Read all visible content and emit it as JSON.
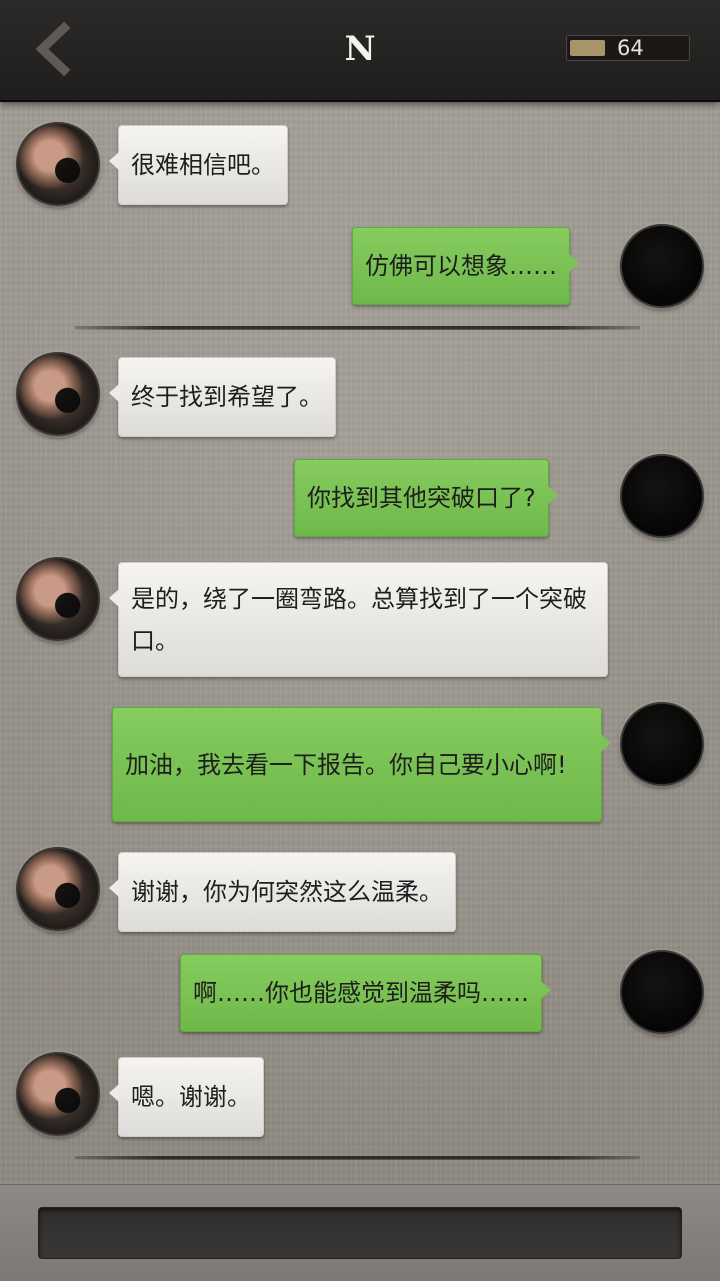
{
  "header": {
    "back_icon": "chevron-left-icon",
    "title": "N",
    "energy": {
      "value": "64",
      "fill_fraction": 0.3,
      "fill_color": "#a8946a"
    }
  },
  "messages": [
    {
      "sender": "npc",
      "text": "很难相信吧。"
    },
    {
      "sender": "me",
      "text": "仿佛可以想象……"
    },
    {
      "type": "divider"
    },
    {
      "sender": "npc",
      "text": "终于找到希望了。"
    },
    {
      "sender": "me",
      "text": "你找到其他突破口了?"
    },
    {
      "sender": "npc",
      "text": "是的，绕了一圈弯路。总算找到了一个突破口。"
    },
    {
      "sender": "me",
      "text": "加油，我去看一下报告。你自己要小心啊!"
    },
    {
      "sender": "npc",
      "text": "谢谢，你为何突然这么温柔。"
    },
    {
      "sender": "me",
      "text": "啊……你也能感觉到温柔吗……"
    },
    {
      "sender": "npc",
      "text": "嗯。谢谢。"
    },
    {
      "type": "divider"
    }
  ],
  "colors": {
    "npc_bubble": "#f0efec",
    "me_bubble": "#7cc255",
    "header_bg": "#252321"
  },
  "input": {
    "value": ""
  }
}
